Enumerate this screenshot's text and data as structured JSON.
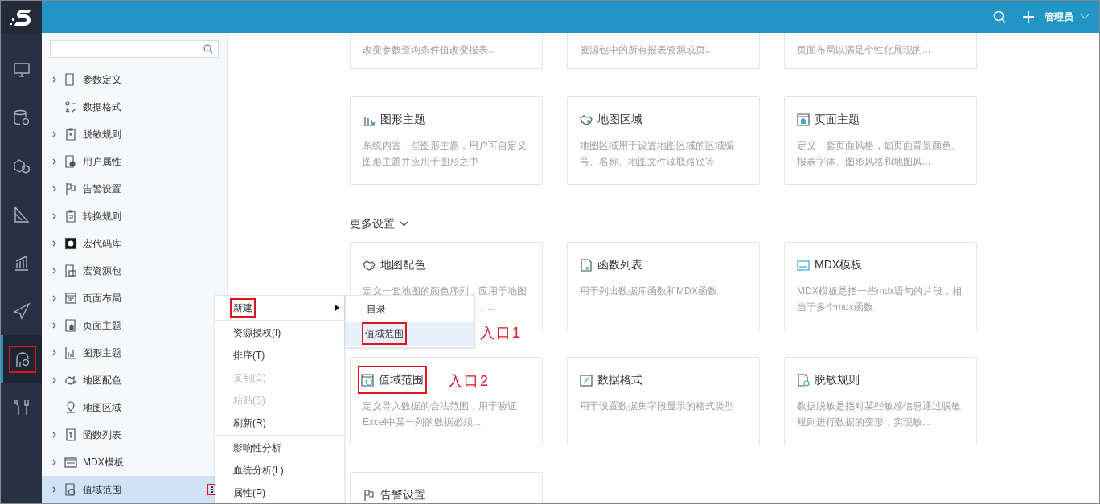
{
  "top_bar": {
    "user": "管理员"
  },
  "rail": [
    {
      "selected": false,
      "marked": false
    },
    {
      "selected": false,
      "marked": false
    },
    {
      "selected": false,
      "marked": false
    },
    {
      "selected": false,
      "marked": false
    },
    {
      "selected": false,
      "marked": false
    },
    {
      "selected": false,
      "marked": false
    },
    {
      "selected": true,
      "marked": true
    },
    {
      "selected": false,
      "marked": false
    }
  ],
  "tree": {
    "items": [
      {
        "label": "参数定义",
        "expandable": true,
        "selected": false
      },
      {
        "label": "数据格式",
        "expandable": false,
        "selected": false
      },
      {
        "label": "脱敏规则",
        "expandable": true,
        "selected": false
      },
      {
        "label": "用户属性",
        "expandable": true,
        "selected": false
      },
      {
        "label": "告警设置",
        "expandable": true,
        "selected": false
      },
      {
        "label": "转换规则",
        "expandable": true,
        "selected": false
      },
      {
        "label": "宏代码库",
        "expandable": true,
        "selected": false
      },
      {
        "label": "宏资源包",
        "expandable": true,
        "selected": false
      },
      {
        "label": "页面布局",
        "expandable": true,
        "selected": false
      },
      {
        "label": "页面主题",
        "expandable": true,
        "selected": false
      },
      {
        "label": "图形主题",
        "expandable": true,
        "selected": false
      },
      {
        "label": "地图配色",
        "expandable": true,
        "selected": false
      },
      {
        "label": "地图区域",
        "expandable": false,
        "selected": false
      },
      {
        "label": "函数列表",
        "expandable": true,
        "selected": false
      },
      {
        "label": "MDX模板",
        "expandable": true,
        "selected": false
      },
      {
        "label": "值域范围",
        "expandable": true,
        "selected": true
      }
    ]
  },
  "context_menu": {
    "groups": [
      [
        {
          "label": "新建",
          "disabled": false,
          "submenu": true,
          "marked": true
        }
      ],
      [
        {
          "label": "资源授权(I)",
          "disabled": false,
          "submenu": false,
          "marked": false
        },
        {
          "label": "排序(T)",
          "disabled": false,
          "submenu": false,
          "marked": false
        },
        {
          "label": "复制(C)",
          "disabled": true,
          "submenu": false,
          "marked": false
        },
        {
          "label": "粘贴(S)",
          "disabled": true,
          "submenu": false,
          "marked": false
        },
        {
          "label": "刷新(R)",
          "disabled": false,
          "submenu": false,
          "marked": false
        }
      ],
      [
        {
          "label": "影响性分析",
          "disabled": false,
          "submenu": false,
          "marked": false
        },
        {
          "label": "血统分析(L)",
          "disabled": false,
          "submenu": false,
          "marked": false
        },
        {
          "label": "属性(P)",
          "disabled": false,
          "submenu": false,
          "marked": false
        }
      ]
    ]
  },
  "submenu": {
    "items": [
      {
        "label": "目录",
        "selected": false,
        "marked": false
      },
      {
        "label": "值域范围",
        "selected": true,
        "marked": true
      }
    ]
  },
  "annotations": [
    {
      "text": "入口1"
    },
    {
      "text": "入口2"
    }
  ],
  "cut_cards": [
    {
      "description": "改变参数查询条件值改变报表..."
    },
    {
      "description": "资源包中的所有报表资源或页..."
    },
    {
      "description": "页面布局以满足个性化展现的..."
    }
  ],
  "cards": [
    {
      "title": "图形主题",
      "description": [
        "系统内置一些图形主题，用户可自定义",
        "图形主题并应用于图形之中"
      ],
      "marked": false
    },
    {
      "title": "地图区域",
      "description": [
        "地图区域用于设置地图区域的区域编",
        "号、名称、地图文件读取路径等"
      ],
      "marked": false
    },
    {
      "title": "页面主题",
      "description": [
        "定义一套页面风格，如页面背景颜色、",
        "报表字体、图形风格和地图风..."
      ],
      "marked": false
    }
  ],
  "more_settings": {
    "heading": "更多设置",
    "cards": [
      {
        "title": "地图配色",
        "description": [
          "定义一套地图的颜色序列，应用于地图",
          "，..."
        ],
        "marked": false,
        "covered": true
      },
      {
        "title": "函数列表",
        "description": [
          "用于列出数据库函数和MDX函数"
        ],
        "marked": false
      },
      {
        "title": "MDX模板",
        "description": [
          "MDX模板是指一些mdx语句的片段，相",
          "当于多个mdx函数"
        ],
        "marked": false
      },
      {
        "title": "值域范围",
        "description": [
          "定义导入数据的合法范围，用于验证",
          "Excel中某一列的数据必须..."
        ],
        "marked": true
      },
      {
        "title": "数据格式",
        "description": [
          "用于设置数据集字段显示的格式类型"
        ],
        "marked": false
      },
      {
        "title": "脱敏规则",
        "description": [
          "数据脱敏是指对某些敏感信息通过脱敏",
          "规则进行数据的变形，实现敏..."
        ],
        "marked": false
      },
      {
        "title": "告警设置",
        "marked": false
      }
    ]
  }
}
